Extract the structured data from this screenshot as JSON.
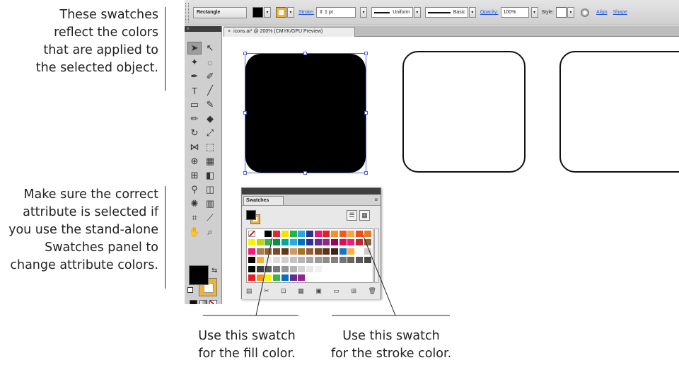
{
  "callouts": {
    "top": [
      "These swatches",
      "reflect the colors",
      "that are applied to",
      "the selected object."
    ],
    "middle": [
      "Make sure the correct",
      "attribute is selected if",
      "you use the stand-alone",
      "Swatches panel to",
      "change attribute colors."
    ],
    "fill": [
      "Use this swatch",
      "for the fill color."
    ],
    "stroke": [
      "Use this swatch",
      "for the stroke color."
    ]
  },
  "control_bar": {
    "object_label": "Rectangle",
    "fill_color": "#000000",
    "stroke_color": "#f2b233",
    "stroke_link": "Stroke:",
    "stroke_weight": "1 pt",
    "profile": "Uniform",
    "brush": "Basic",
    "opacity_link": "Opacity:",
    "opacity_value": "100%",
    "style_label": "Style:",
    "align_link": "Align",
    "shape_link": "Shape"
  },
  "document_tab": {
    "close": "×",
    "title": "icons.ai* @ 200% (CMYK/GPU Preview)"
  },
  "swatches_panel": {
    "title": "Swatches",
    "menu_icon": "panel-menu-icon",
    "rows": [
      [
        "none",
        "#ffffff",
        "#000000",
        "#e6252a",
        "#f9e000",
        "#25b34b",
        "#28a9e1",
        "#2e3192",
        "#e7167b",
        "#ed1c24",
        "#f7941d",
        "#f15a24",
        "#f7a53c",
        "#e94e1b",
        "#ea7725"
      ],
      [
        "#f8f400",
        "#c4d600",
        "#39b54a",
        "#009245",
        "#00a79d",
        "#29abe2",
        "#0071bc",
        "#2e3192",
        "#662d91",
        "#93278f",
        "#9e005d",
        "#d4145a",
        "#ed1e79",
        "#c1272d",
        "#8c6239"
      ],
      [
        "#ed1e79",
        "#a67c52",
        "#8c6239",
        "#754c24",
        "#603813",
        "#c69c6d",
        "#a3702e",
        "#8b5e3c",
        "#7a4a1c",
        "#5c3317",
        "#3c2415",
        "#1b75bb",
        "#fbb040",
        "#ffffff",
        "#cccccc"
      ],
      [
        "#000000",
        "#f2b233",
        "#e9e9e9",
        "#dddddd",
        "#cfcfcf",
        "#c2c2c2",
        "#b5b5b5",
        "#a7a7a7",
        "#9a9a9a",
        "#8c8c8c",
        "#808080",
        "#737373",
        "#656565",
        "#585858",
        "#4a4a4a"
      ],
      [
        "#000000",
        "#3c3c3c",
        "#5a5a5a",
        "#787878",
        "#969696",
        "#b4b4b4",
        "#d2d2d2",
        "#e6e6e6",
        "#f0f0f0",
        "",
        "",
        "",
        "",
        "",
        ""
      ],
      [
        "#ed1c24",
        "#f7941d",
        "#f8f400",
        "#39b54a",
        "#0071bc",
        "#662d91",
        "#93278f",
        "",
        "",
        "",
        "",
        "",
        "",
        "",
        ""
      ]
    ]
  },
  "icons": {
    "selection": "selection-tool-icon",
    "direct": "direct-selection-tool-icon"
  }
}
